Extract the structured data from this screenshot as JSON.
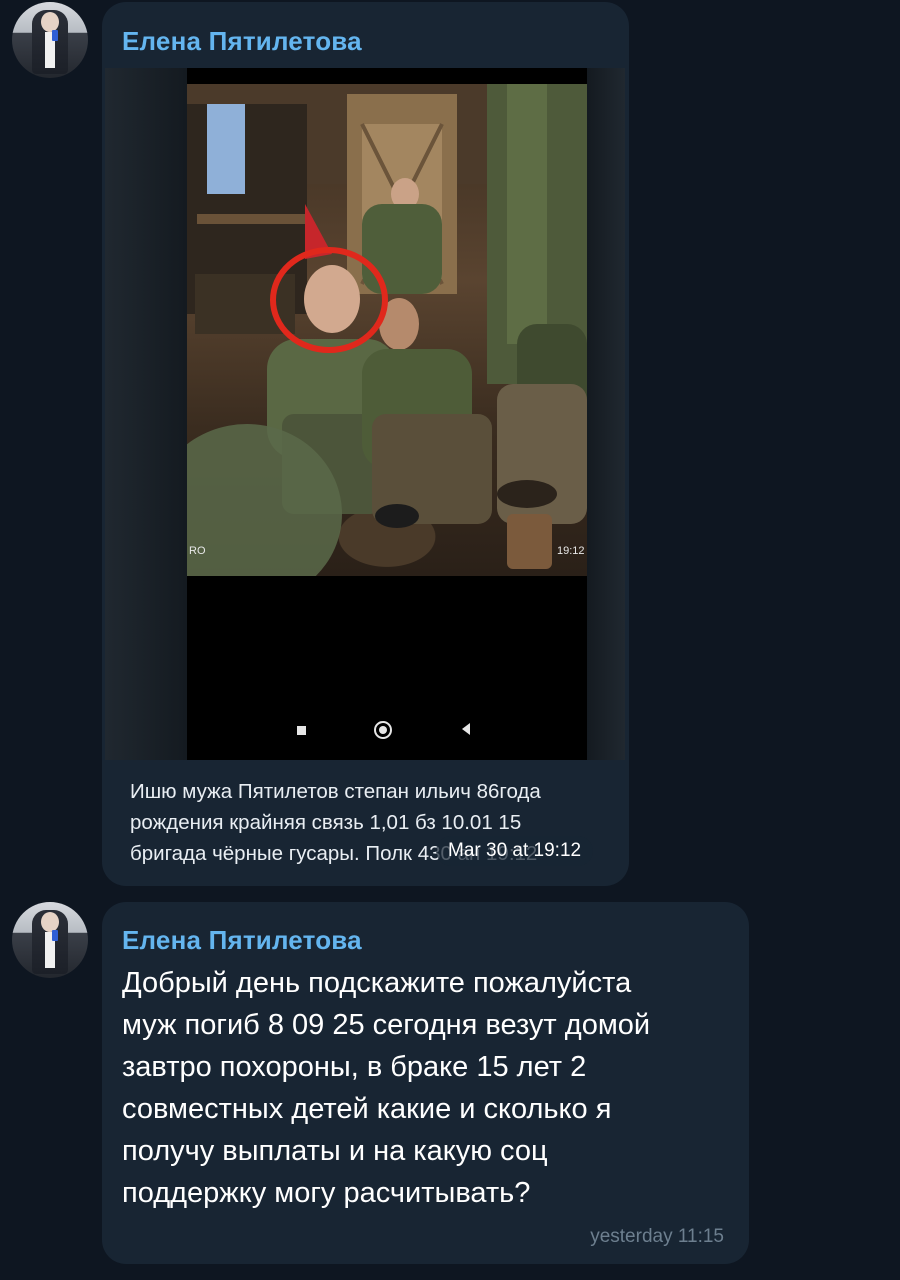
{
  "messages": [
    {
      "sender": "Елена Пятилетова",
      "photo": {
        "left_label": "RO",
        "right_label": "19:12"
      },
      "caption_lines": [
        "Ишю мужа Пятилетов степан ильич 86года",
        "рождения крайняя связь 1,01 бз 10.01   15",
        "бригада чёрные гусары. Полк 430 ан 19:12"
      ],
      "time": "Mar 30 at 19:12"
    },
    {
      "sender": "Елена Пятилетова",
      "text_lines": [
        "Добрый день подскажите пожалуйста",
        "муж погиб 8 09  25 сегодня везут домой",
        "завтро похороны, в браке 15 лет 2",
        "совместных детей какие и сколько я",
        "получу выплаты и на какую соц",
        "поддержку могу расчитывать?"
      ],
      "time": "yesterday 11:15"
    }
  ],
  "colors": {
    "background": "#0e1621",
    "bubble": "#182533",
    "sender_name": "#64b5ef",
    "timestamp": "#6d7f8f",
    "highlight_circle": "#e0281c"
  },
  "icons": [
    "nav-recent-icon",
    "nav-home-icon",
    "nav-back-icon"
  ]
}
